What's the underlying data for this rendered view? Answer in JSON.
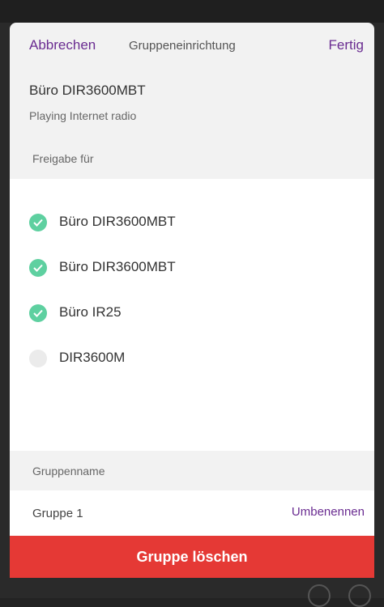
{
  "header": {
    "cancel_label": "Abbrechen",
    "title": "Gruppeneinrichtung",
    "done_label": "Fertig"
  },
  "device": {
    "name": "Büro DIR3600MBT",
    "status": "Playing Internet radio"
  },
  "share": {
    "label": "Freigabe für",
    "items": [
      {
        "label": "Büro DIR3600MBT",
        "checked": true
      },
      {
        "label": "Büro DIR3600MBT",
        "checked": true
      },
      {
        "label": "Büro IR25",
        "checked": true
      },
      {
        "label": "DIR3600M",
        "checked": false
      }
    ]
  },
  "group": {
    "name_label": "Gruppenname",
    "name_value": "Gruppe 1",
    "rename_label": "Umbenennen"
  },
  "delete_label": "Gruppe löschen",
  "colors": {
    "accent": "#6a2c91",
    "check_on": "#5ed0a0",
    "check_off": "#ebebeb",
    "danger": "#e53935"
  },
  "icons": {
    "check": "checkmark-icon"
  }
}
